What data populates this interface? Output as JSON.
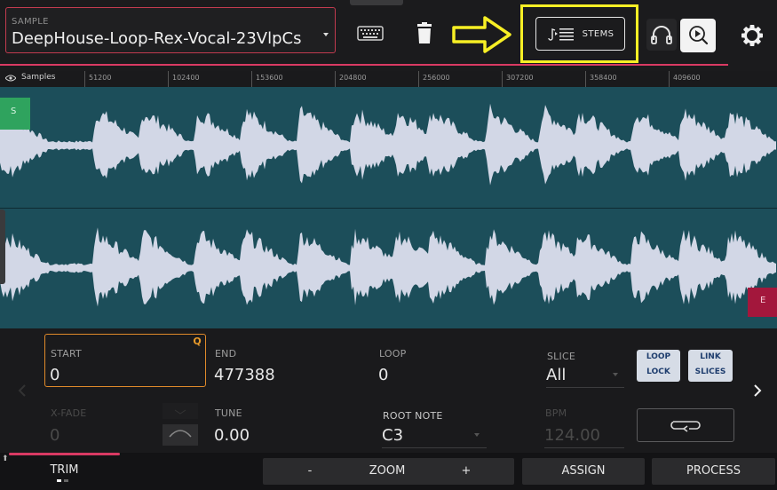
{
  "header": {
    "sample_label": "SAMPLE",
    "sample_name": "DeepHouse-Loop-Rex-Vocal-23VlpCs",
    "stems_label": "STEMS",
    "icons": [
      "keyboard-icon",
      "trash-icon",
      "arrow-right-icon",
      "stems-icon",
      "headphones-icon",
      "preview-icon",
      "gear-icon"
    ],
    "accent_color": "#d93a63",
    "highlight_color": "#f7ef25"
  },
  "ruler": {
    "label": "Samples",
    "ticks": [
      "51200",
      "102400",
      "153600",
      "204800",
      "256000",
      "307200",
      "358400",
      "409600"
    ]
  },
  "waveform": {
    "start_marker": "S",
    "end_marker": "E",
    "background_color": "#1c4e5a",
    "wave_color": "#d2d7e6"
  },
  "controls": {
    "start_label": "START",
    "start_value": "0",
    "quantize_badge": "Q",
    "end_label": "END",
    "end_value": "477388",
    "loop_label": "LOOP",
    "loop_value": "0",
    "slice_label": "SLICE",
    "slice_value": "All",
    "loop_lock_line1": "LOOP",
    "loop_lock_line2": "LOCK",
    "link_slices_line1": "LINK",
    "link_slices_line2": "SLICES",
    "xfade_label": "X-FADE",
    "xfade_value": "0",
    "tune_label": "TUNE",
    "tune_value": "0.00",
    "root_note_label": "ROOT NOTE",
    "root_note_value": "C3",
    "bpm_label": "BPM",
    "bpm_value": "124.00"
  },
  "bottom": {
    "trim_label": "TRIM",
    "zoom_minus": "-",
    "zoom_label": "ZOOM",
    "zoom_plus": "+",
    "assign_label": "ASSIGN",
    "process_label": "PROCESS"
  }
}
